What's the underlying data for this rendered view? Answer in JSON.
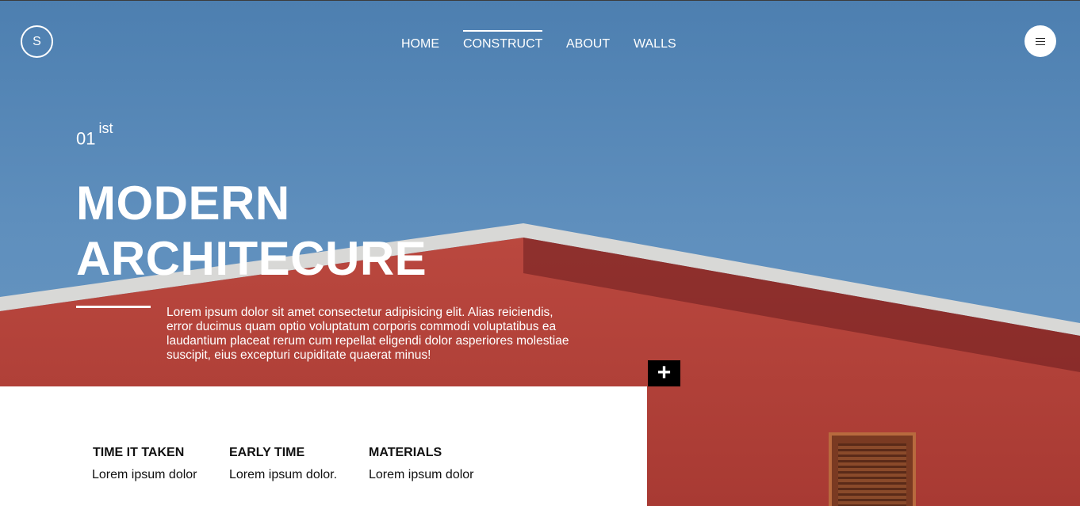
{
  "brand": {
    "logo_letter": "S"
  },
  "nav": {
    "items": [
      {
        "label": "HOME"
      },
      {
        "label": "CONSTRUCT",
        "active": true
      },
      {
        "label": "ABOUT"
      },
      {
        "label": "WALLS"
      }
    ]
  },
  "menu": {
    "icon": "hamburger-icon"
  },
  "hero": {
    "index_number": "01",
    "index_suffix": "ist",
    "headline_line1": "MODERN",
    "headline_line2": "ARCHITECURE",
    "description": "Lorem ipsum dolor sit amet consectetur adipisicing elit. Alias reiciendis, error ducimus quam optio voluptatum corporis commodi voluptatibus ea laudantium placeat rerum cum repellat eligendi dolor asperiores molestiae suscipit, eius excepturi cupiditate quaerat minus!",
    "plus_label": "+"
  },
  "info": {
    "columns": [
      {
        "title": "TIME IT TAKEN",
        "text": "Lorem ipsum dolor"
      },
      {
        "title": "EARLY TIME",
        "text": "Lorem ipsum dolor."
      },
      {
        "title": "MATERIALS",
        "text": "Lorem ipsum dolor"
      }
    ]
  },
  "colors": {
    "sky": "#5f8fbd",
    "wall": "#b9473e",
    "text_light": "#ffffff",
    "button_dark": "#000000"
  }
}
